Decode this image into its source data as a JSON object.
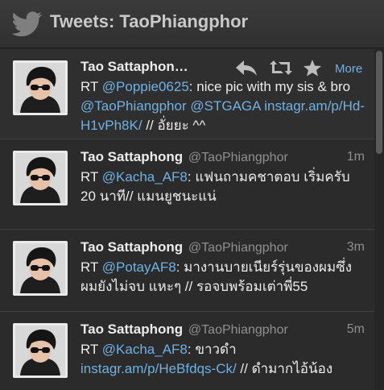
{
  "header": {
    "title": "Tweets: TaoPhiangphor",
    "logo_icon": "twitter-bird-icon"
  },
  "colors": {
    "background": "#2b2b2b",
    "link": "#6fb1e3",
    "muted": "#8f8f8f"
  },
  "tweets": [
    {
      "name": "Tao Sattaphon…",
      "handle": "",
      "time": "",
      "rt": "RT ",
      "mention1": "@Poppie0625",
      "text1": ": nice pic with my sis & bro ",
      "mention2": "@TaoPhiangphor",
      "text2": " ",
      "mention3": "@STGAGA",
      "text3": " ",
      "link": "instagr.am/p/Hd-H1vPh8K/",
      "text4": " // อั่ยยะ ^^",
      "actions": {
        "reply_icon": "reply-icon",
        "retweet_icon": "retweet-icon",
        "favorite_icon": "star-icon",
        "more_label": "More"
      }
    },
    {
      "name": "Tao Sattaphong",
      "handle": "@TaoPhiangphor",
      "time": "1m",
      "rt": "RT ",
      "mention1": "@Kacha_AF8",
      "text1": ": แฟนถามคชาตอบ เริ่มครับ 20 นาที// แมนยูชนะแน่"
    },
    {
      "name": "Tao Sattaphong",
      "handle": "@TaoPhiangphor",
      "time": "3m",
      "rt": "RT ",
      "mention1": "@PotayAF8",
      "text1": ": มางานบายเนียร์รุ่นของผมซึ่งผมยังไม่จบ แหะๆ // รอจบพร้อมเต่าพี่55"
    },
    {
      "name": "Tao Sattaphong",
      "handle": "@TaoPhiangphor",
      "time": "5m",
      "rt": "RT ",
      "mention1": "@Kacha_AF8",
      "text1": ": ขาวดำ ",
      "link": "instagr.am/p/HeBfdqs-Ck/",
      "text2": " // ดำมากไอ้น้อง"
    }
  ]
}
